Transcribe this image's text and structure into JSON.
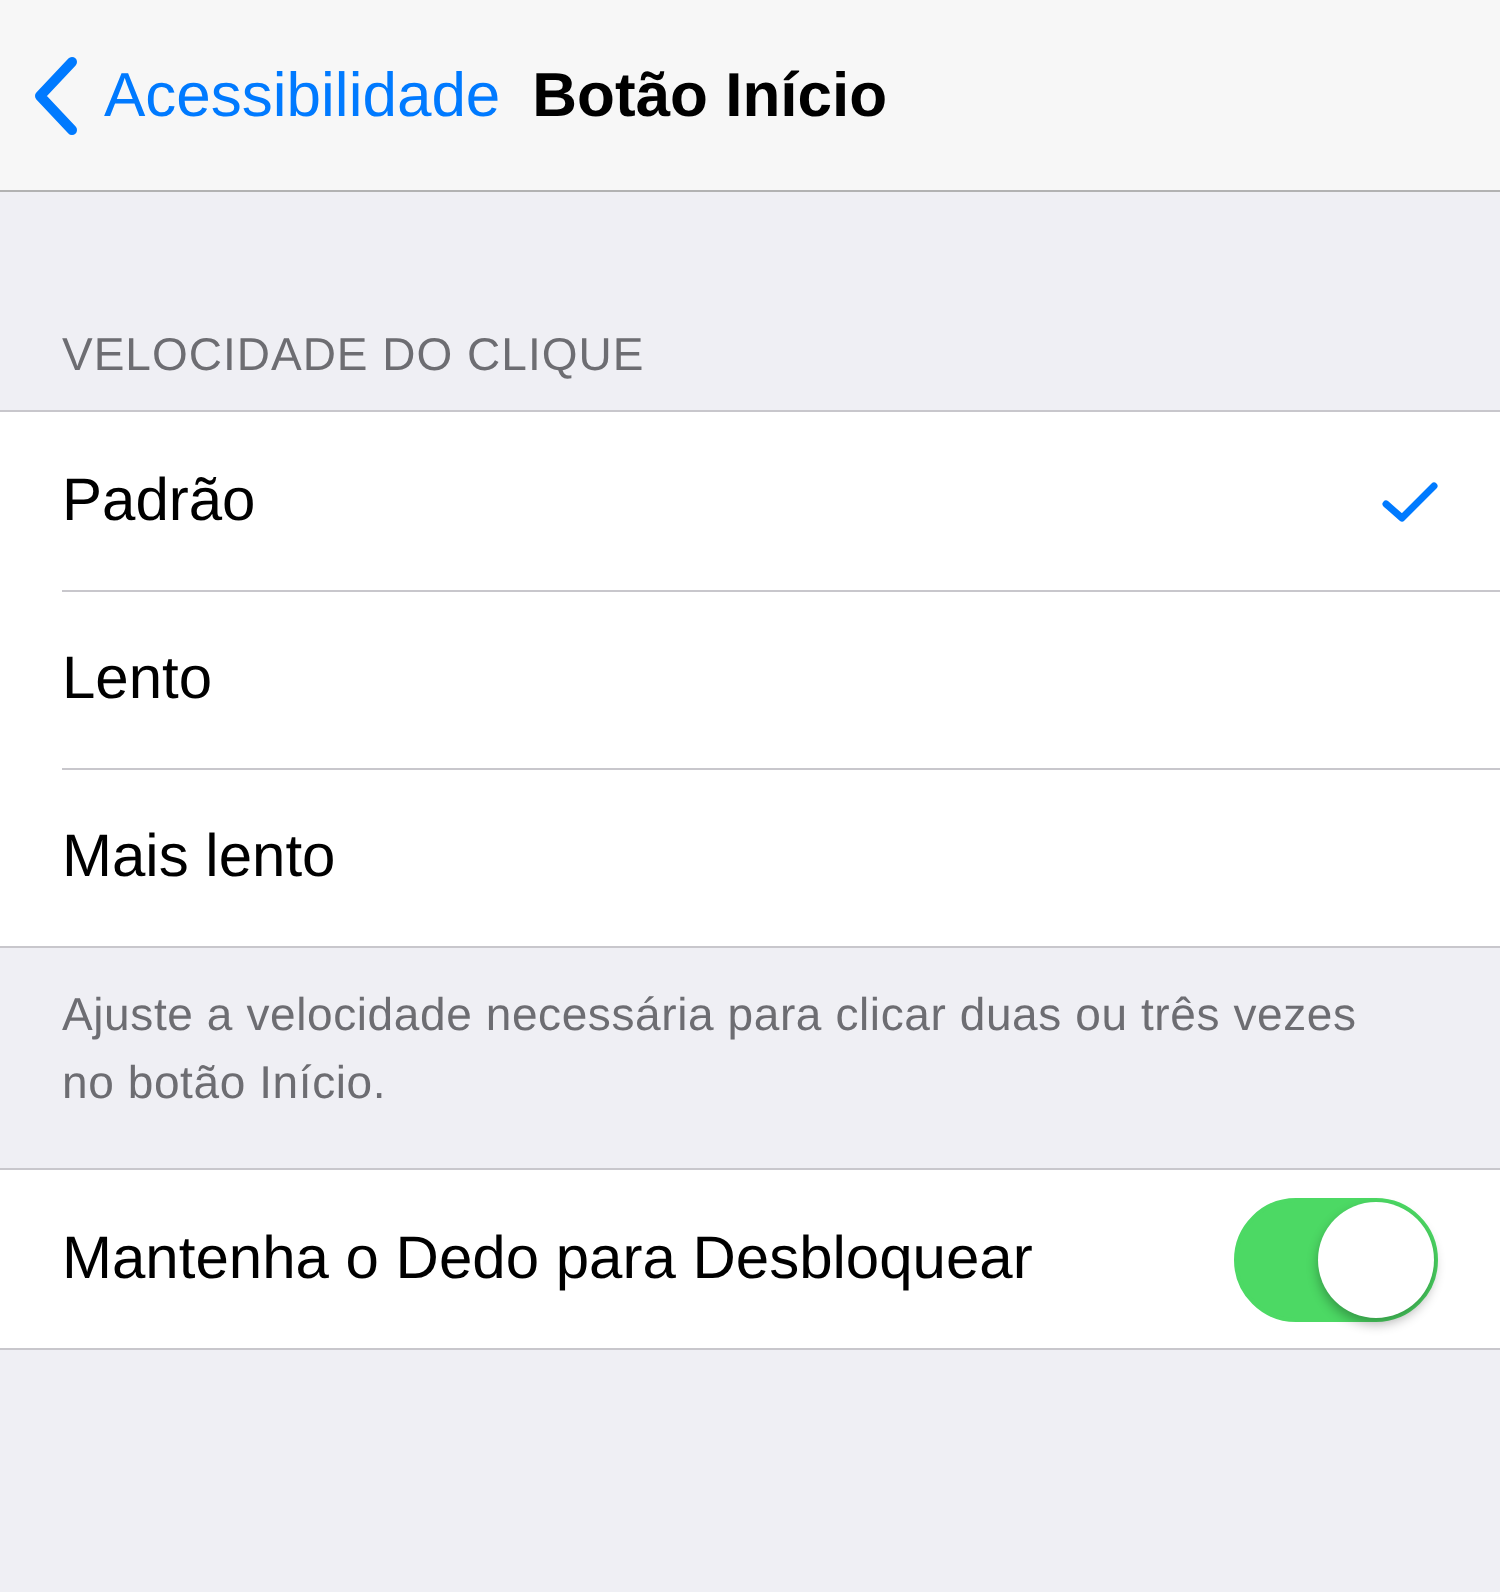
{
  "nav": {
    "back_label": "Acessibilidade",
    "title": "Botão Início"
  },
  "section_header": "VELOCIDADE DO CLIQUE",
  "options": [
    {
      "label": "Padrão",
      "selected": true
    },
    {
      "label": "Lento",
      "selected": false
    },
    {
      "label": "Mais lento",
      "selected": false
    }
  ],
  "footer": "Ajuste a velocidade necessária para clicar duas ou três vezes no botão Início.",
  "toggle": {
    "label": "Mantenha o Dedo para Desbloquear",
    "on": true
  }
}
